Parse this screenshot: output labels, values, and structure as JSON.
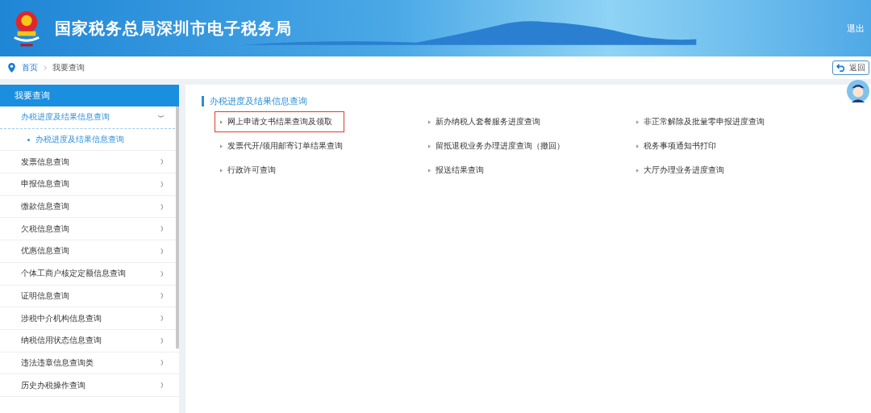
{
  "header": {
    "title": "国家税务总局深圳市电子税务局",
    "logout": "退出"
  },
  "breadcrumb": {
    "items": [
      "首页",
      "我要查询"
    ],
    "back": "返回"
  },
  "sidebar": {
    "title": "我要查询",
    "items": [
      {
        "label": "办税进度及结果信息查询",
        "expanded": true,
        "children": [
          {
            "label": "办税进度及结果信息查询",
            "selected": true
          }
        ]
      },
      {
        "label": "发票信息查询",
        "expanded": false
      },
      {
        "label": "申报信息查询",
        "expanded": false
      },
      {
        "label": "缴款信息查询",
        "expanded": false
      },
      {
        "label": "欠税信息查询",
        "expanded": false
      },
      {
        "label": "优惠信息查询",
        "expanded": false
      },
      {
        "label": "个体工商户核定定额信息查询",
        "expanded": false
      },
      {
        "label": "证明信息查询",
        "expanded": false
      },
      {
        "label": "涉税中介机构信息查询",
        "expanded": false
      },
      {
        "label": "纳税信用状态信息查询",
        "expanded": false
      },
      {
        "label": "违法违章信息查询类",
        "expanded": false
      },
      {
        "label": "历史办税操作查询",
        "expanded": false
      }
    ]
  },
  "main": {
    "section_title": "办税进度及结果信息查询",
    "links": [
      {
        "label": "网上申请文书结果查询及领取",
        "highlighted": true
      },
      {
        "label": "新办纳税人套餐服务进度查询",
        "highlighted": false
      },
      {
        "label": "非正常解除及批量零申报进度查询",
        "highlighted": false
      },
      {
        "label": "发票代开/领用邮寄订单结果查询",
        "highlighted": false
      },
      {
        "label": "留抵退税业务办理进度查询（撤回）",
        "highlighted": false
      },
      {
        "label": "税务事项通知书打印",
        "highlighted": false
      },
      {
        "label": "行政许可查询",
        "highlighted": false
      },
      {
        "label": "报送结果查询",
        "highlighted": false
      },
      {
        "label": "大厅办理业务进度查询",
        "highlighted": false
      }
    ]
  }
}
